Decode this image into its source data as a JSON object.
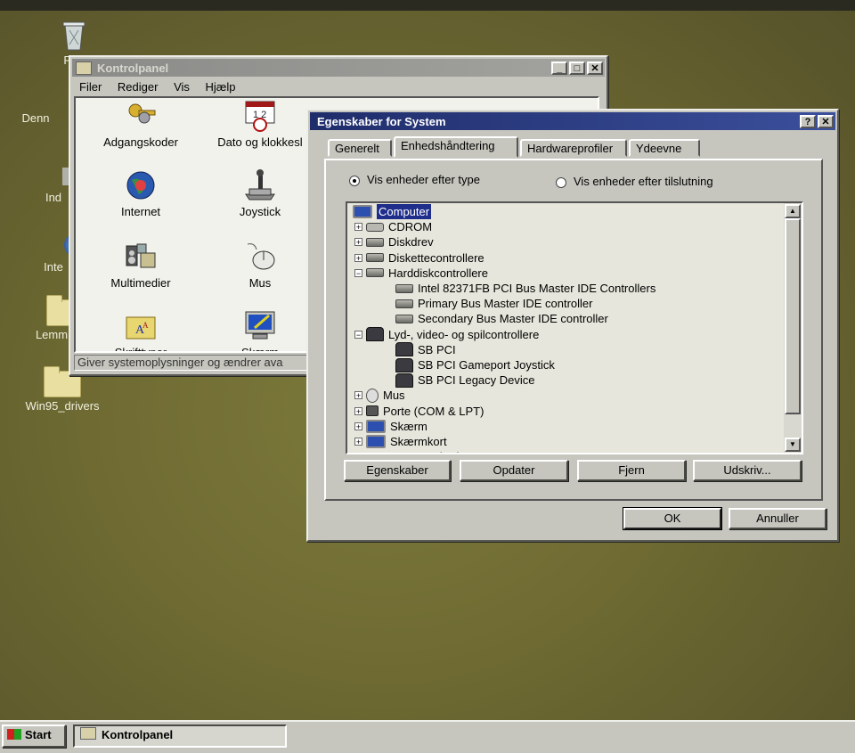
{
  "desktop": {
    "icons": [
      {
        "label": "Pap",
        "icon": "recycle-bin-icon"
      },
      {
        "label": "Denn",
        "icon": "my-computer-icon"
      },
      {
        "label": "Ind",
        "icon": "inbox-icon"
      },
      {
        "label": "Inte",
        "icon": "internet-icon"
      },
      {
        "label": "Lemm",
        "icon": "folder-icon"
      },
      {
        "label": "Win95_drivers",
        "icon": "folder-icon"
      }
    ]
  },
  "control_panel": {
    "title": "Kontrolpanel",
    "menu": [
      "Filer",
      "Rediger",
      "Vis",
      "Hjælp"
    ],
    "items": [
      {
        "label": "Adgangskoder",
        "icon": "keys-icon"
      },
      {
        "label": "Dato og klokkesl",
        "icon": "calendar-clock-icon"
      },
      {
        "label": "Internet",
        "icon": "globe-icon"
      },
      {
        "label": "Joystick",
        "icon": "joystick-icon"
      },
      {
        "label": "Multimedier",
        "icon": "multimedia-icon"
      },
      {
        "label": "Mus",
        "icon": "mouse-icon"
      },
      {
        "label": "Skrifttyper",
        "icon": "fonts-folder-icon"
      },
      {
        "label": "Skærm",
        "icon": "display-icon"
      }
    ],
    "status": "Giver systemoplysninger og ændrer ava"
  },
  "system_dialog": {
    "title": "Egenskaber for System",
    "tabs": [
      "Generelt",
      "Enhedshåndtering",
      "Hardwareprofiler",
      "Ydeevne"
    ],
    "selected_tab": "Enhedshåndtering",
    "radio_by_type": "Vis enheder efter type",
    "radio_by_connection": "Vis enheder efter tilslutning",
    "tree": [
      {
        "label": "Computer",
        "level": 0,
        "selected": true
      },
      {
        "label": "CDROM",
        "level": 1,
        "expander": "+"
      },
      {
        "label": "Diskdrev",
        "level": 1,
        "expander": "+"
      },
      {
        "label": "Diskettecontrollere",
        "level": 1,
        "expander": "+"
      },
      {
        "label": "Harddiskcontrollere",
        "level": 1,
        "expander": "−"
      },
      {
        "label": "Intel 82371FB PCI Bus Master IDE Controllers",
        "level": 2
      },
      {
        "label": "Primary Bus Master IDE controller",
        "level": 2
      },
      {
        "label": "Secondary Bus Master IDE controller",
        "level": 2
      },
      {
        "label": "Lyd-, video- og spilcontrollere",
        "level": 1,
        "expander": "−"
      },
      {
        "label": "SB PCI",
        "level": 2
      },
      {
        "label": "SB PCI Gameport Joystick",
        "level": 2
      },
      {
        "label": "SB PCI Legacy Device",
        "level": 2
      },
      {
        "label": "Mus",
        "level": 1,
        "expander": "+"
      },
      {
        "label": "Porte (COM & LPT)",
        "level": 1,
        "expander": "+"
      },
      {
        "label": "Skærm",
        "level": 1,
        "expander": "+"
      },
      {
        "label": "Skærmkort",
        "level": 1,
        "expander": "+"
      },
      {
        "label": "Systemenheder",
        "level": 1,
        "expander": "+"
      }
    ],
    "buttons": {
      "properties": "Egenskaber",
      "refresh": "Opdater",
      "remove": "Fjern",
      "print": "Udskriv...",
      "ok": "OK",
      "cancel": "Annuller"
    }
  },
  "taskbar": {
    "start": "Start",
    "task": "Kontrolpanel"
  }
}
